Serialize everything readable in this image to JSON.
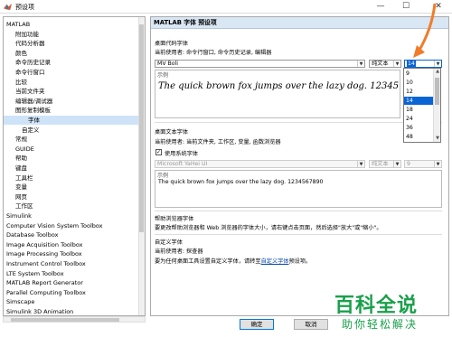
{
  "window": {
    "title": "预设项",
    "minimize": "—",
    "maximize": "☐",
    "close": "✕"
  },
  "tree": {
    "items": [
      {
        "label": "MATLAB",
        "indent": 0
      },
      {
        "label": "附加功能",
        "indent": 1
      },
      {
        "label": "代码分析器",
        "indent": 1
      },
      {
        "label": "颜色",
        "indent": 1
      },
      {
        "label": "命令历史记录",
        "indent": 1
      },
      {
        "label": "命令行窗口",
        "indent": 1
      },
      {
        "label": "比较",
        "indent": 1
      },
      {
        "label": "当前文件夹",
        "indent": 1
      },
      {
        "label": "编辑器/调试器",
        "indent": 1
      },
      {
        "label": "图形复制模板",
        "indent": 1
      },
      {
        "label": "字体",
        "indent": 1,
        "selected": true
      },
      {
        "label": "自定义",
        "indent": 2
      },
      {
        "label": "常规",
        "indent": 1
      },
      {
        "label": "GUIDE",
        "indent": 1
      },
      {
        "label": "帮助",
        "indent": 1
      },
      {
        "label": "键盘",
        "indent": 1
      },
      {
        "label": "工具栏",
        "indent": 1
      },
      {
        "label": "变量",
        "indent": 1
      },
      {
        "label": "网页",
        "indent": 1
      },
      {
        "label": "工作区",
        "indent": 1
      },
      {
        "label": "Simulink",
        "indent": 0
      },
      {
        "label": "Computer Vision System Toolbox",
        "indent": 0
      },
      {
        "label": "Database Toolbox",
        "indent": 0
      },
      {
        "label": "Image Acquisition Toolbox",
        "indent": 0
      },
      {
        "label": "Image Processing Toolbox",
        "indent": 0
      },
      {
        "label": "Instrument Control Toolbox",
        "indent": 0
      },
      {
        "label": "LTE System Toolbox",
        "indent": 0
      },
      {
        "label": "MATLAB Report Generator",
        "indent": 0
      },
      {
        "label": "Parallel Computing Toolbox",
        "indent": 0
      },
      {
        "label": "Simscape",
        "indent": 0
      },
      {
        "label": "Simulink 3D Animation",
        "indent": 0
      }
    ]
  },
  "panel": {
    "header": "MATLAB 字体 预设项",
    "desktop_code": {
      "title": "桌面代码字体",
      "usage": "当前使用者: 命令行窗口, 命令历史记录, 编辑器",
      "font": "MV Boli",
      "style": "纯文本",
      "size": "14",
      "sample_caption": "示例",
      "sample_text": "The quick brown fox jumps over the lazy dog. 12345"
    },
    "size_dropdown": {
      "options": [
        "9",
        "10",
        "12",
        "14",
        "18",
        "24",
        "36",
        "48"
      ],
      "selected": "14"
    },
    "desktop_text": {
      "title": "桌面文本字体",
      "usage": "当前使用者: 当前文件夹, 工作区, 变量, 函数浏览器",
      "checkbox_label": "使用系统字体",
      "checked": true,
      "font": "Microsoft YaHei UI",
      "style": "纯文本",
      "size": "9",
      "sample_caption": "示例",
      "sample_text": "The quick brown fox jumps over the lazy dog. 1234567890"
    },
    "help_browser": {
      "title": "帮助浏览器字体",
      "text": "要更改帮助浏览器和 Web 浏览器的字体大小，请右键点击页面，然后选择\"放大\"或\"缩小\"。"
    },
    "custom": {
      "title": "自定义字体",
      "usage": "当前使用者: 探查器",
      "text_prefix": "要为任何桌面工具设置自定义字体，请转至",
      "link": "自定义字体",
      "text_suffix": "预设项。"
    }
  },
  "buttons": {
    "ok": "确定",
    "cancel": "取消"
  },
  "watermark": {
    "big": "百科全说",
    "small": "助你轻松解决"
  },
  "colors": {
    "accent": "#0a64d4",
    "header_bg": "#d9e6f4",
    "arrow": "#f07c2b",
    "logo": "#1aa04a"
  }
}
